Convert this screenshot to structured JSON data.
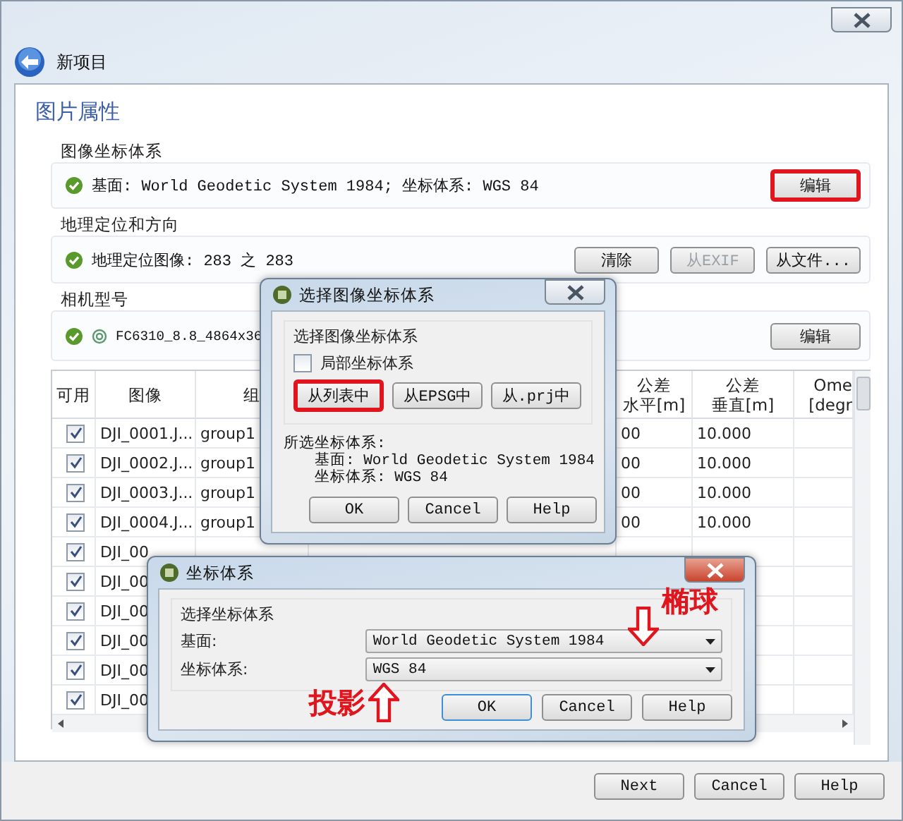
{
  "window": {
    "title": "新项目"
  },
  "page_title": "图片属性",
  "sections": [
    {
      "kind": "crs",
      "title": "图像坐标体系",
      "ok": true,
      "text": "基面: World Geodetic System 1984; 坐标体系: WGS 84",
      "buttons": [
        {
          "label": "编辑",
          "disabled": false,
          "highlighted": true
        }
      ]
    },
    {
      "kind": "geo",
      "title": "地理定位和方向",
      "ok": true,
      "text": "地理定位图像: 283 之 283",
      "buttons": [
        {
          "label": "清除",
          "disabled": false,
          "highlighted": false
        },
        {
          "label": "从EXIF",
          "disabled": true,
          "highlighted": false
        },
        {
          "label": "从文件...",
          "disabled": false,
          "highlighted": false
        }
      ]
    },
    {
      "kind": "camera",
      "title": "相机型号",
      "ok": true,
      "text": "FC6310_8.8_4864x36",
      "buttons": [
        {
          "label": "编辑",
          "disabled": false,
          "highlighted": false
        }
      ]
    }
  ],
  "table": {
    "columns": [
      {
        "label": "可用"
      },
      {
        "label": "图像"
      },
      {
        "label": "组"
      },
      {
        "label": "公差",
        "sublabel": "水平[m]"
      },
      {
        "label": "公差",
        "sublabel": "垂直[m]"
      },
      {
        "label": "Ome",
        "sublabel": "[degr"
      }
    ],
    "rows": [
      {
        "enabled": true,
        "image": "DJI_0001.J...",
        "group": "group1",
        "tol_h": "00",
        "tol_v": "10.000"
      },
      {
        "enabled": true,
        "image": "DJI_0002.J...",
        "group": "group1",
        "tol_h": "00",
        "tol_v": "10.000"
      },
      {
        "enabled": true,
        "image": "DJI_0003.J...",
        "group": "group1",
        "tol_h": "00",
        "tol_v": "10.000"
      },
      {
        "enabled": true,
        "image": "DJI_0004.J...",
        "group": "group1",
        "tol_h": "00",
        "tol_v": "10.000"
      },
      {
        "enabled": true,
        "image": "DJI_00"
      },
      {
        "enabled": true,
        "image": "DJI_00"
      },
      {
        "enabled": true,
        "image": "DJI_00"
      },
      {
        "enabled": true,
        "image": "DJI_00"
      },
      {
        "enabled": true,
        "image": "DJI_00"
      },
      {
        "enabled": true,
        "image": "DJI_00"
      }
    ]
  },
  "footer_buttons": [
    "Next",
    "Cancel",
    "Help"
  ],
  "crs_dialog": {
    "title": "选择图像坐标体系",
    "active": false,
    "group_title": "选择图像坐标体系",
    "local_crs": {
      "label": "局部坐标体系",
      "checked": false
    },
    "sources": [
      {
        "label": "从列表中",
        "highlighted": true
      },
      {
        "label": "从EPSG中",
        "highlighted": false
      },
      {
        "label": "从.prj中",
        "highlighted": false
      }
    ],
    "selected_title": "所选坐标体系:",
    "selected_lines": [
      "基面: World Geodetic System 1984",
      "坐标体系: WGS 84"
    ],
    "buttons": [
      {
        "label": "OK",
        "default": false
      },
      {
        "label": "Cancel",
        "default": false
      },
      {
        "label": "Help",
        "default": false
      }
    ]
  },
  "cs_dialog": {
    "title": "坐标体系",
    "active": true,
    "group_title": "选择坐标体系",
    "fields": [
      {
        "label": "基面:",
        "value": "World Geodetic System 1984"
      },
      {
        "label": "坐标体系:",
        "value": "WGS 84"
      }
    ],
    "buttons": [
      {
        "label": "OK",
        "default": true
      },
      {
        "label": "Cancel",
        "default": false
      },
      {
        "label": "Help",
        "default": false
      }
    ]
  },
  "annotations": [
    {
      "text": "椭球",
      "kind": "down"
    },
    {
      "text": "投影",
      "kind": "up"
    }
  ]
}
